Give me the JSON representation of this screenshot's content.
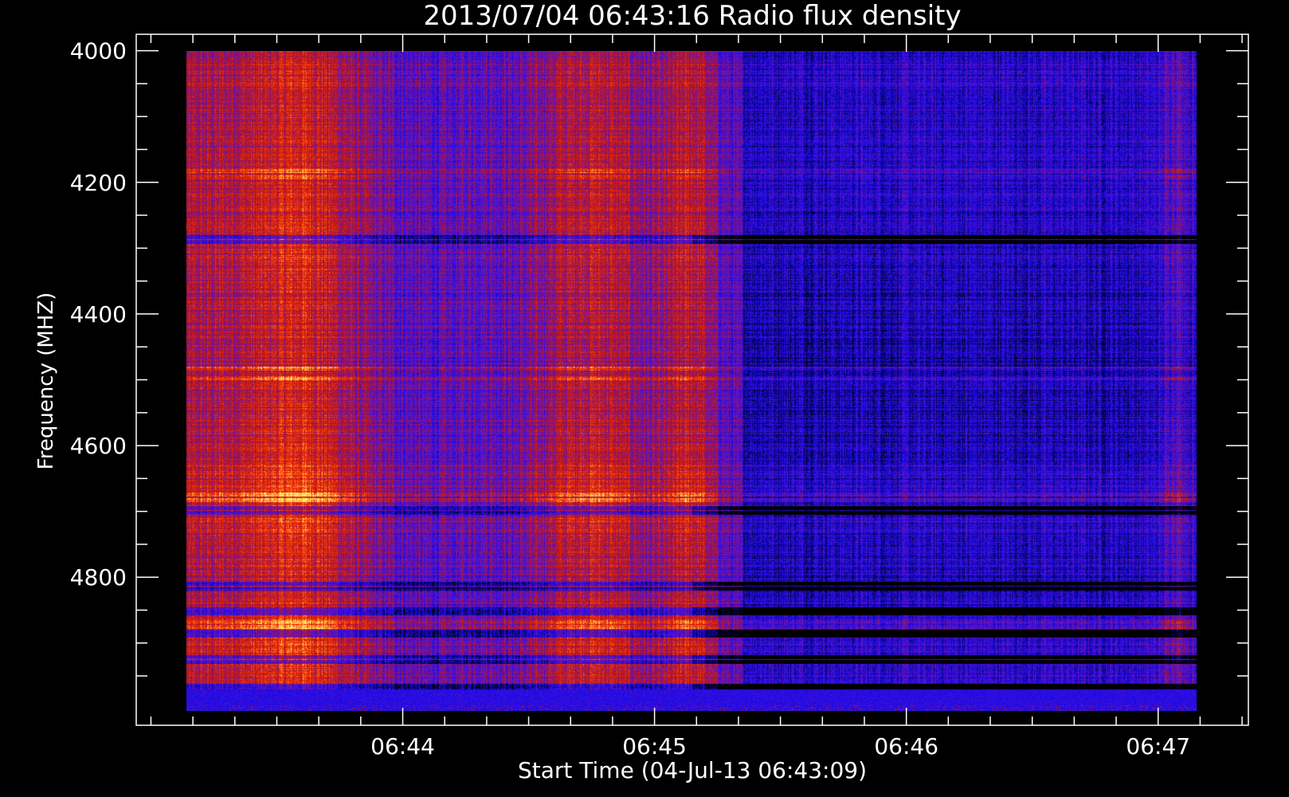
{
  "chart_data": {
    "type": "heatmap",
    "title": "2013/07/04 06:43:16 Radio flux density",
    "xlabel": "Start Time (04-Jul-13 06:43:09)",
    "ylabel": "Frequency (MHZ)",
    "x_ticks": [
      {
        "label": "06:44",
        "value": 51
      },
      {
        "label": "06:45",
        "value": 111
      },
      {
        "label": "06:46",
        "value": 171
      },
      {
        "label": "06:47",
        "value": 231
      }
    ],
    "xlim": [
      -12.5,
      252.5
    ],
    "data_x_range": [
      0,
      240
    ],
    "y_ticks": [
      4000,
      4200,
      4400,
      4600,
      4800
    ],
    "ylim": [
      4000,
      5025
    ],
    "data_y_range": [
      4000,
      5000
    ],
    "colormap": [
      "#000000",
      "#0000ff",
      "#b00000",
      "#ff3000",
      "#ffff60"
    ],
    "frame_color": "#ffffff",
    "background": "#000000"
  }
}
